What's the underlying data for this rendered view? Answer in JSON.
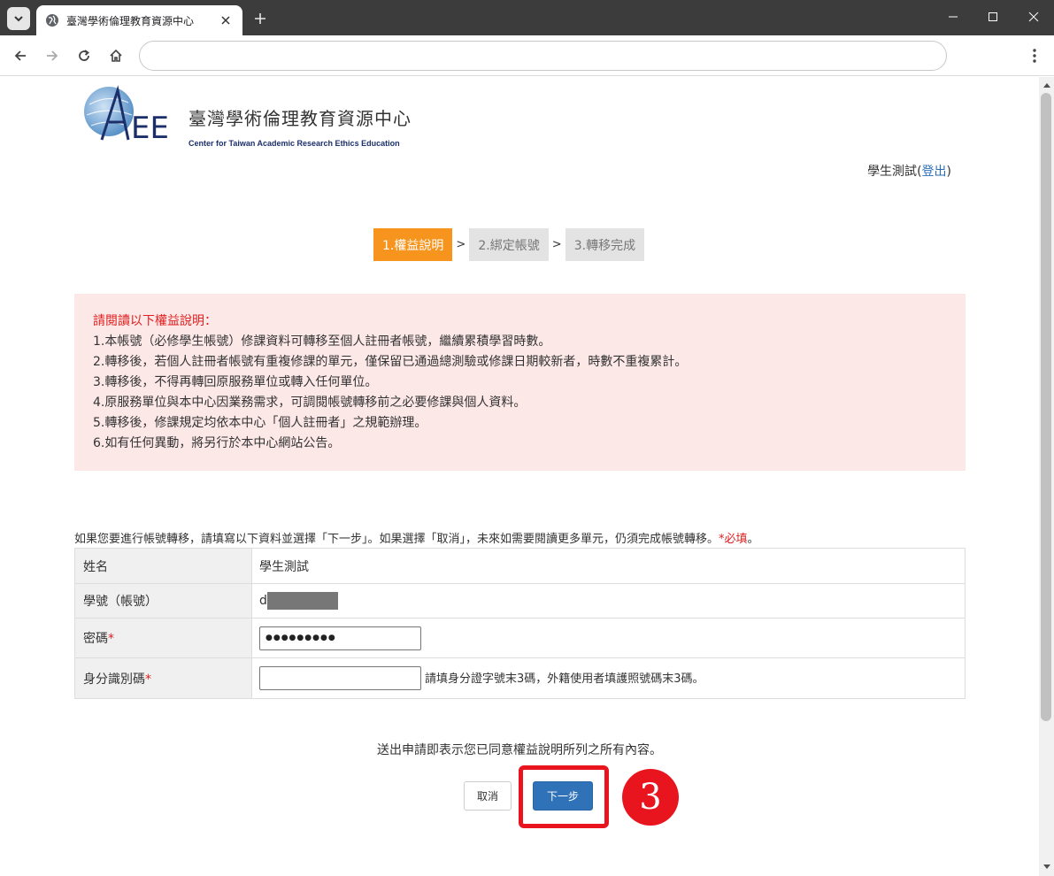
{
  "browser": {
    "tab_title": "臺灣學術倫理教育資源中心",
    "address": ""
  },
  "logo": {
    "title": "臺灣學術倫理教育資源中心",
    "subtitle": "Center for Taiwan Academic Research Ethics Education",
    "mark_text": "AREE"
  },
  "user": {
    "name": "學生測試",
    "open_paren": "(",
    "logout_label": "登出",
    "close_paren": ")"
  },
  "steps": {
    "items": [
      "1.權益說明",
      "2.綁定帳號",
      "3.轉移完成"
    ],
    "separator": ">",
    "active_index": 0
  },
  "notice": {
    "heading": "請閱讀以下權益說明：",
    "lines": [
      "1.本帳號（必修學生帳號）修課資料可轉移至個人註冊者帳號，繼續累積學習時數。",
      "2.轉移後，若個人註冊者帳號有重複修課的單元，僅保留已通過總測驗或修課日期較新者，時數不重複累計。",
      "3.轉移後，不得再轉回原服務單位或轉入任何單位。",
      "4.原服務單位與本中心因業務需求，可調閱帳號轉移前之必要修課與個人資料。",
      "5.轉移後，修課規定均依本中心「個人註冊者」之規範辦理。",
      "6.如有任何異動，將另行於本中心網站公告。"
    ]
  },
  "form": {
    "intro": "如果您要進行帳號轉移，請填寫以下資料並選擇「下一步」。如果選擇「取消」，未來如需要閱讀更多單元，仍須完成帳號轉移。",
    "required_note": "*必填",
    "intro_end": "。",
    "rows": {
      "name_label": "姓名",
      "name_value": "學生測試",
      "id_label": "學號（帳號）",
      "id_value_prefix": "d",
      "password_label": "密碼",
      "password_value": "●●●●●●●●●",
      "idcard_label": "身分識別碼",
      "idcard_value": "",
      "idcard_hint": "請填身分證字號末3碼，外籍使用者填護照號碼末3碼。"
    },
    "required_mark": "*"
  },
  "consent": "送出申請即表示您已同意權益說明所列之所有內容。",
  "buttons": {
    "cancel": "取消",
    "next": "下一步"
  },
  "annotation": {
    "step_number": "3"
  },
  "colors": {
    "step_active": "#f7941d",
    "primary_button": "#2f72b7",
    "highlight": "#e8141e",
    "notice_bg": "#fde8e8"
  }
}
